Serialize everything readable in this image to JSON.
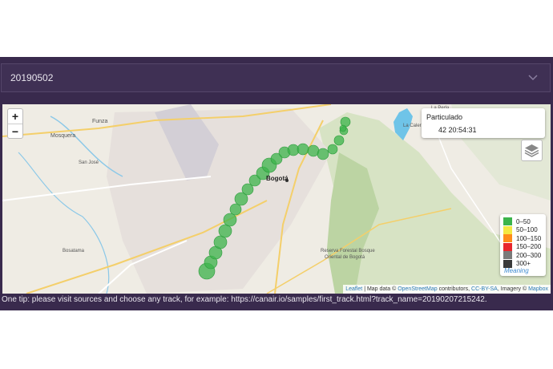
{
  "date_select": {
    "value": "20190502"
  },
  "map": {
    "zoom_in": "+",
    "zoom_out": "−",
    "popup": {
      "title": "Particulado",
      "value": "42 20:54:31"
    },
    "place_labels": {
      "city": "Bogotá",
      "funza": "Funza",
      "mosquera": "Mosquera",
      "reserve_1": "Reserva Forestal Bosque",
      "reserve_2": "Oriental de Bogotá",
      "calera": "La Calera",
      "sanjose": "San José",
      "bosatama": "Bosatama",
      "laperla": "La Perla"
    },
    "legend": {
      "items": [
        {
          "label": "0–50",
          "color": "#3cb44b"
        },
        {
          "label": "50–100",
          "color": "#f4e842"
        },
        {
          "label": "100–150",
          "color": "#ff8c1a"
        },
        {
          "label": "150–200",
          "color": "#e8262d"
        },
        {
          "label": "200–300",
          "color": "#7a7a7a"
        },
        {
          "label": "300+",
          "color": "#3a3a3a"
        }
      ],
      "meaning": "Meaning"
    },
    "attribution": {
      "leaflet": "Leaflet",
      "sep1": " | Map data © ",
      "osm": "OpenStreetMap",
      "contrib": " contributors, ",
      "ccbysa": "CC-BY-SA",
      "imagery": ", Imagery © ",
      "mapbox": "Mapbox"
    }
  },
  "tip": "One tip: please visit sources and choose any track, for example: https://canair.io/samples/first_track.html?track_name=20190207215242."
}
